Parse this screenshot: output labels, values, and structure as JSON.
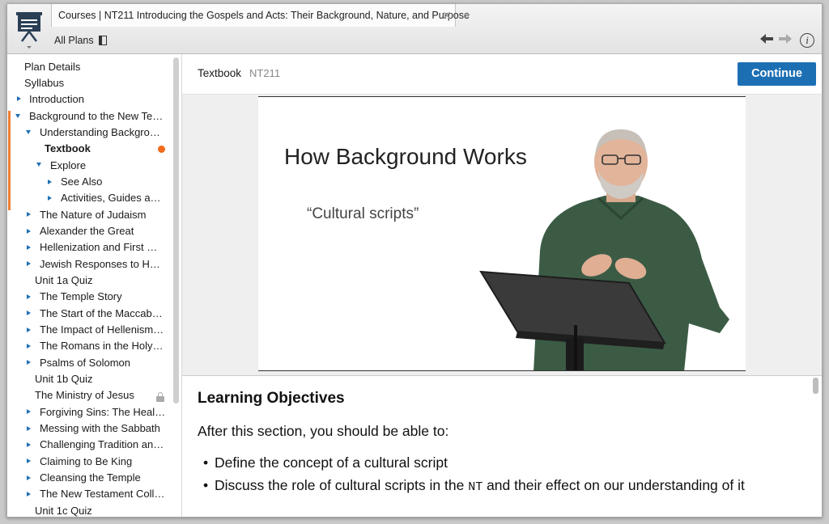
{
  "tab": {
    "title": "Courses | NT211 Introducing the Gospels and Acts: Their Background, Nature, and Purpose",
    "close_icon": "✕",
    "add_icon": "+"
  },
  "header": {
    "all_plans": "All Plans"
  },
  "sidebar": {
    "items": [
      {
        "label": "Plan Details"
      },
      {
        "label": "Syllabus"
      },
      {
        "label": "Introduction"
      },
      {
        "label": "Background to the New Te…"
      },
      {
        "label": "Understanding Backgro…"
      },
      {
        "label": "Textbook"
      },
      {
        "label": "Explore"
      },
      {
        "label": "See Also"
      },
      {
        "label": "Activities, Guides an…"
      },
      {
        "label": "The Nature of Judaism"
      },
      {
        "label": "Alexander the Great"
      },
      {
        "label": "Hellenization and First M…"
      },
      {
        "label": "Jewish Responses to He…"
      },
      {
        "label": "Unit 1a Quiz"
      },
      {
        "label": "The Temple Story"
      },
      {
        "label": "The Start of the Maccabe…"
      },
      {
        "label": "The Impact of Hellenism…"
      },
      {
        "label": "The Romans in the Holy …"
      },
      {
        "label": "Psalms of Solomon"
      },
      {
        "label": "Unit 1b Quiz"
      },
      {
        "label": "The Ministry of Jesus"
      },
      {
        "label": "Forgiving Sins: The Heal…"
      },
      {
        "label": "Messing with the Sabbath"
      },
      {
        "label": "Challenging Tradition an…"
      },
      {
        "label": "Claiming to Be King"
      },
      {
        "label": "Cleansing the Temple"
      },
      {
        "label": "The New Testament Coll…"
      },
      {
        "label": "Unit 1c Quiz"
      }
    ]
  },
  "main": {
    "label": "Textbook",
    "code": "NT211",
    "continue_label": "Continue",
    "slide": {
      "title": "How Background Works",
      "subtitle": "“Cultural scripts”"
    },
    "learning": {
      "heading": "Learning Objectives",
      "intro": "After this section, you should be able to:",
      "bullet_1_pre": "Define the concept of a cultural script",
      "bullet_2_pre": "Discuss the role of cultural scripts in the ",
      "bullet_2_abbr": "NT",
      "bullet_2_post": " and their effect on our understanding of it"
    }
  },
  "colors": {
    "accent": "#1d6fb4",
    "current_marker": "#f26a1b",
    "progress_strip": "#f07f34",
    "tree_arrow": "#1f6fb5"
  }
}
